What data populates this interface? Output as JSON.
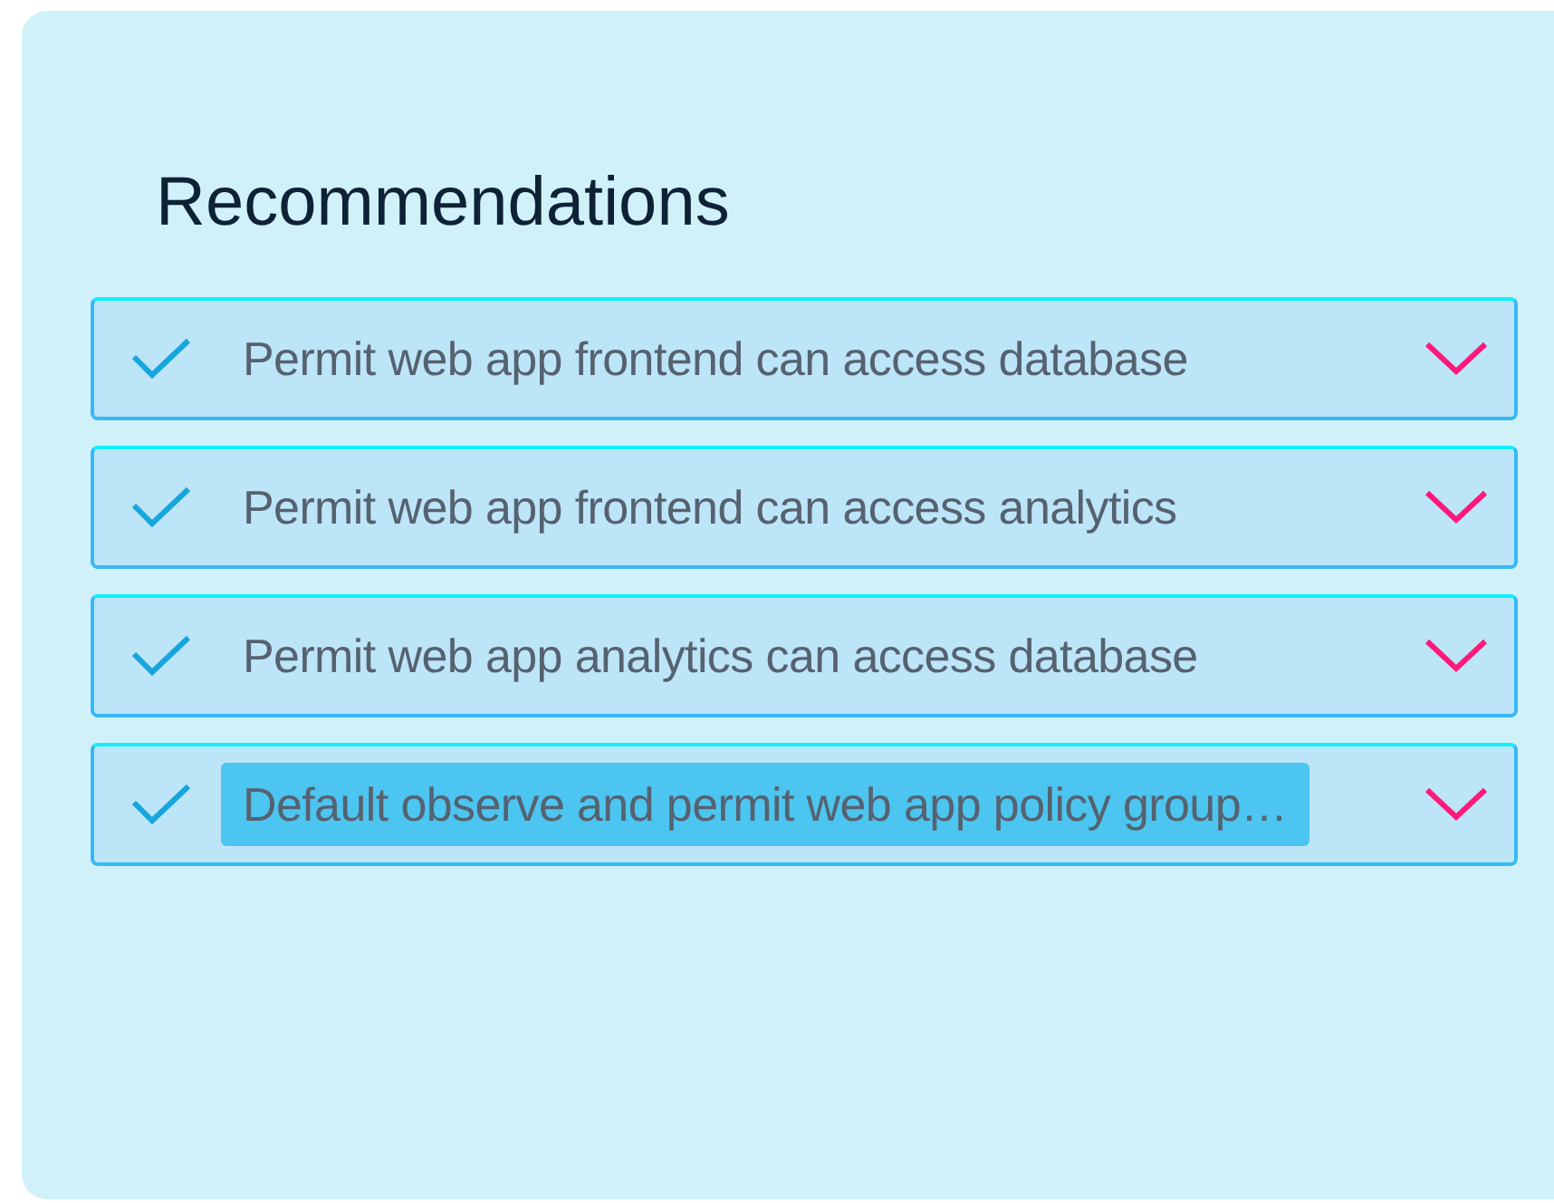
{
  "panel": {
    "title": "Recommendations",
    "items": [
      {
        "label": "Permit web app frontend can access database",
        "checked": true,
        "highlighted": false
      },
      {
        "label": "Permit web app frontend can access analytics",
        "checked": true,
        "highlighted": false
      },
      {
        "label": "Permit web app analytics can access database",
        "checked": true,
        "highlighted": false
      },
      {
        "label": "Default observe and permit web app policy group…",
        "checked": true,
        "highlighted": true
      }
    ]
  }
}
